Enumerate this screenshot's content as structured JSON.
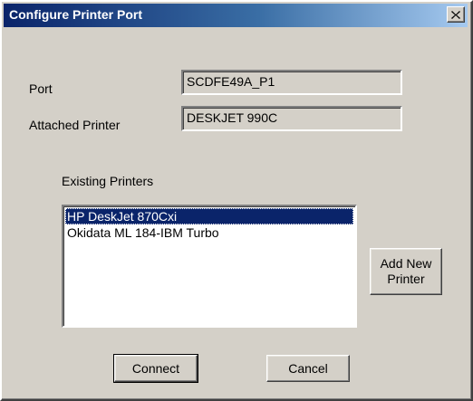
{
  "window": {
    "title": "Configure Printer Port",
    "close_glyph": "×"
  },
  "form": {
    "port_label": "Port",
    "port_value": "SCDFE49A_P1",
    "attached_printer_label": "Attached Printer",
    "attached_printer_value": "DESKJET 990C"
  },
  "printers": {
    "label": "Existing Printers",
    "items": [
      {
        "label": "HP DeskJet 870Cxi",
        "selected": true
      },
      {
        "label": "Okidata ML 184-IBM Turbo",
        "selected": false
      }
    ]
  },
  "buttons": {
    "add_new_printer_line1": "Add New",
    "add_new_printer_line2": "Printer",
    "connect": "Connect",
    "cancel": "Cancel"
  },
  "colors": {
    "dialog_face": "#d4d0c8",
    "titlebar_start": "#0a246a",
    "titlebar_end": "#a6caf0",
    "selection": "#0a246a"
  },
  "icons": {
    "close": "close-icon"
  }
}
